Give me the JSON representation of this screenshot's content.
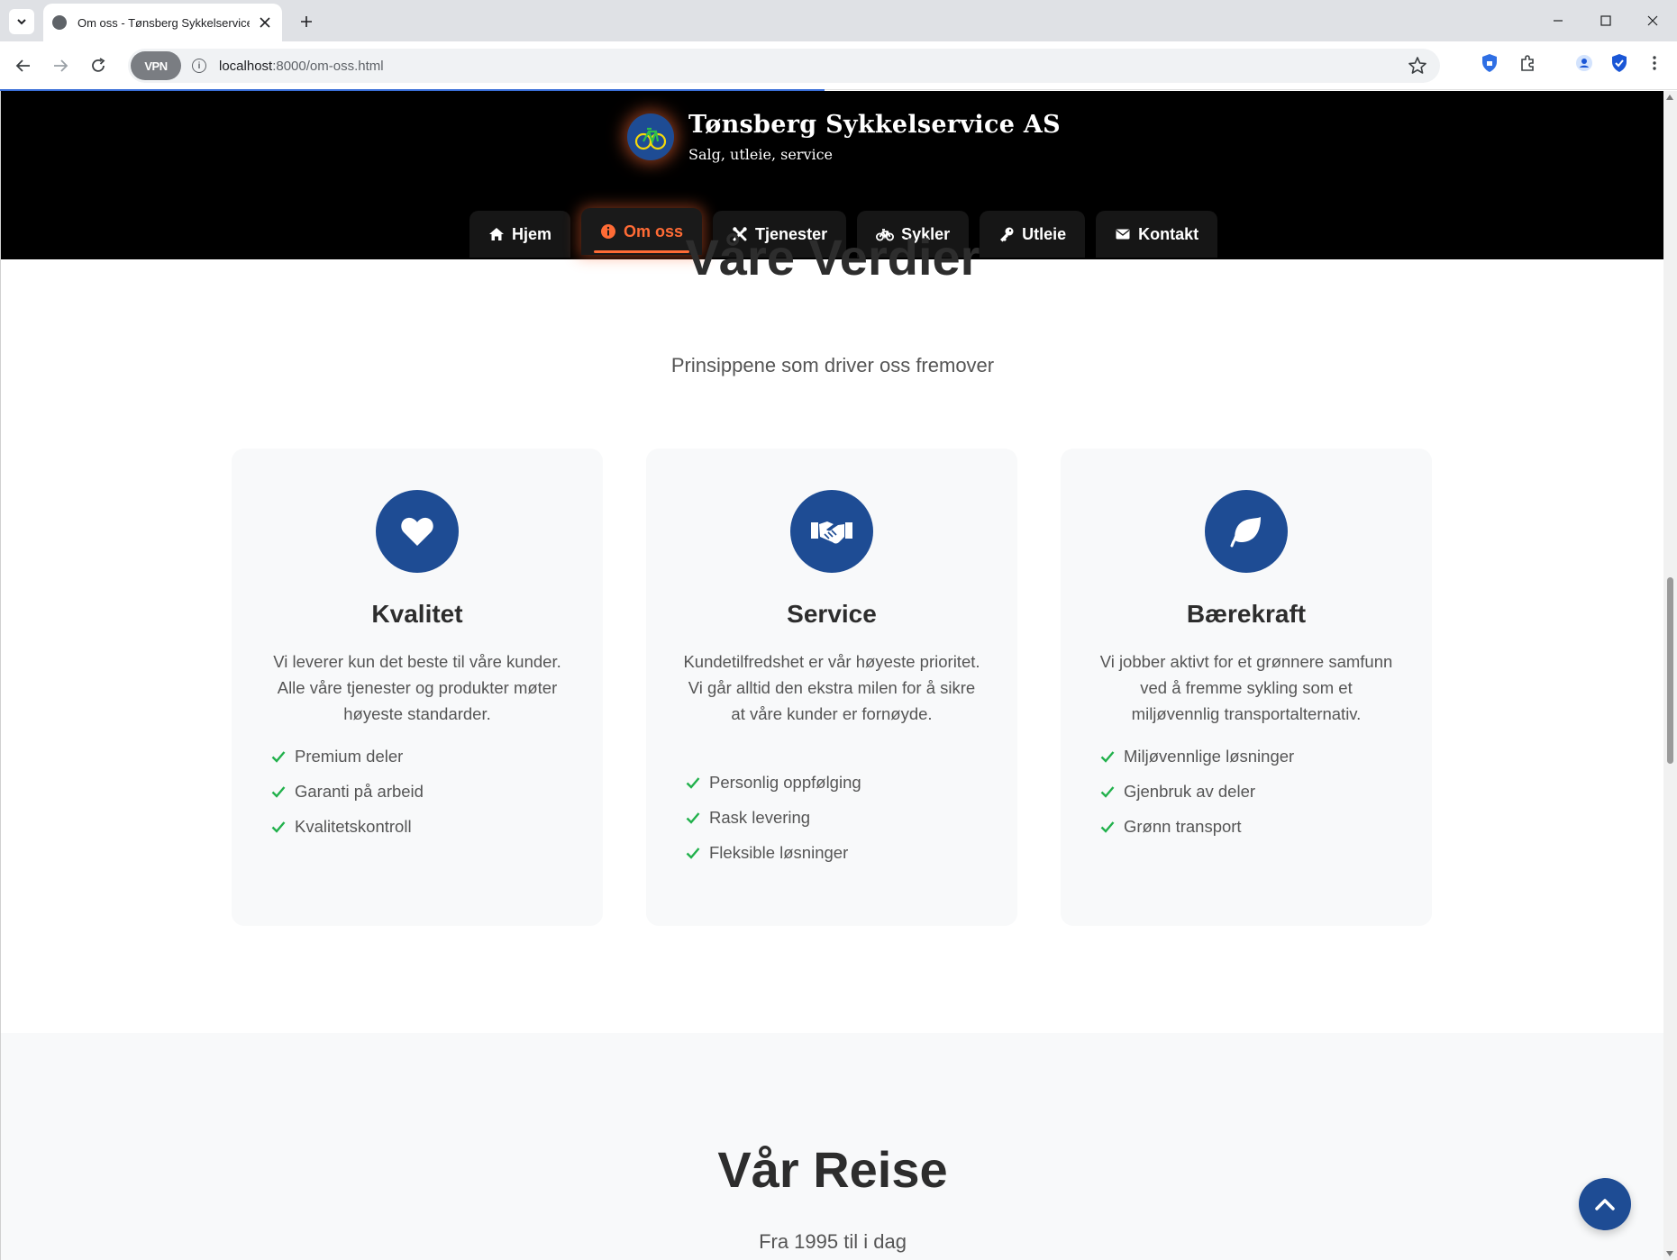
{
  "browser": {
    "tab_title": "Om oss - Tønsberg Sykkelservice c",
    "url_host": "localhost",
    "url_rest": ":8000/om-oss.html",
    "vpn_label": "VPN"
  },
  "site": {
    "brand_name": "Tønsberg Sykkelservice AS",
    "tagline": "Salg, utleie, service",
    "nav": [
      {
        "label": "Hjem",
        "icon": "home-icon"
      },
      {
        "label": "Om oss",
        "icon": "info-icon",
        "active": true
      },
      {
        "label": "Tjenester",
        "icon": "tools-icon"
      },
      {
        "label": "Sykler",
        "icon": "bicycle-icon"
      },
      {
        "label": "Utleie",
        "icon": "key-icon"
      },
      {
        "label": "Kontakt",
        "icon": "envelope-icon"
      }
    ],
    "accent_color": "#ff6b35",
    "primary_color": "#1e4c94"
  },
  "values": {
    "title": "Våre Verdier",
    "subtitle": "Prinsippene som driver oss fremover",
    "cards": [
      {
        "icon": "heart-icon",
        "title": "Kvalitet",
        "description": "Vi leverer kun det beste til våre kunder. Alle våre tjenester og produkter møter høyeste standarder.",
        "items": [
          "Premium deler",
          "Garanti på arbeid",
          "Kvalitetskontroll"
        ]
      },
      {
        "icon": "handshake-icon",
        "title": "Service",
        "description": "Kundetilfredshet er vår høyeste prioritet. Vi går alltid den ekstra milen for å sikre at våre kunder er fornøyde.",
        "items": [
          "Personlig oppfølging",
          "Rask levering",
          "Fleksible løsninger"
        ]
      },
      {
        "icon": "leaf-icon",
        "title": "Bærekraft",
        "description": "Vi jobber aktivt for et grønnere samfunn ved å fremme sykling som et miljøvennlig transportalternativ.",
        "items": [
          "Miljøvennlige løsninger",
          "Gjenbruk av deler",
          "Grønn transport"
        ]
      }
    ]
  },
  "journey": {
    "title": "Vår Reise",
    "subtitle": "Fra 1995 til i dag"
  }
}
